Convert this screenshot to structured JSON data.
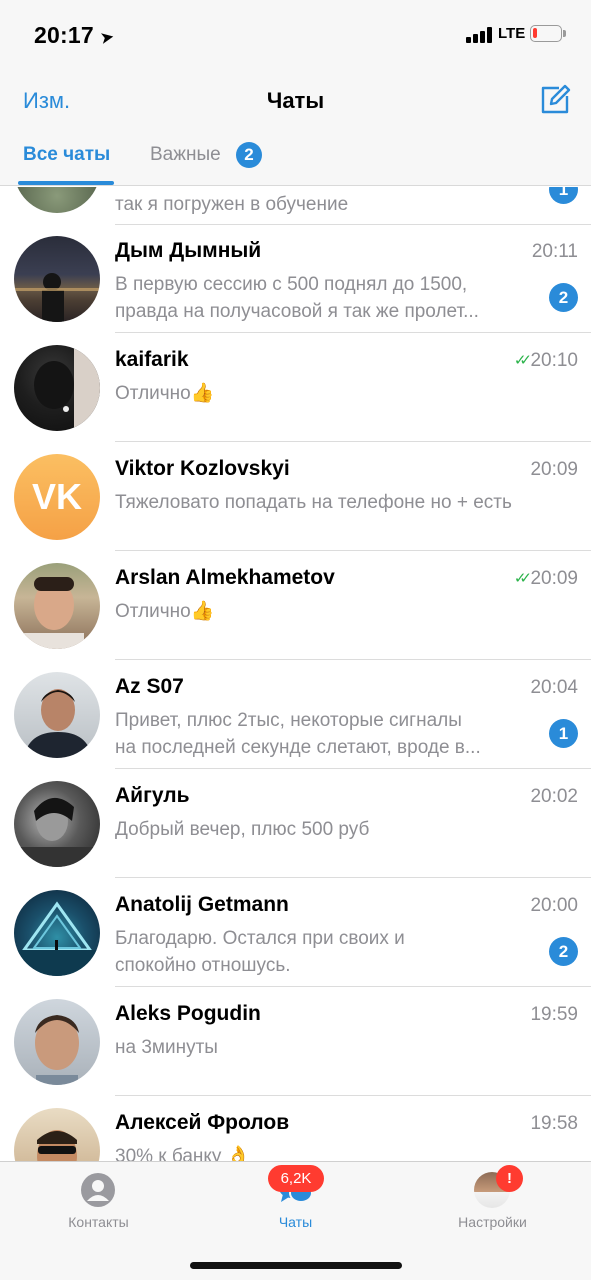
{
  "status_bar": {
    "time": "20:17",
    "network": "LTE"
  },
  "nav": {
    "edit_label": "Изм.",
    "title": "Чаты"
  },
  "filter_tabs": {
    "all_label": "Все чаты",
    "important_label": "Важные",
    "important_badge": "2"
  },
  "chats": [
    {
      "name": "",
      "time": "",
      "preview_1": "так я погружен в обучение",
      "preview_2": "",
      "badge": "1",
      "read": false,
      "avatar_icon": "photo-avatar"
    },
    {
      "name": "Дым Дымный",
      "time": "20:11",
      "preview_1": "В первую сессию с 500 поднял до 1500,",
      "preview_2": "правда на получасовой я так же пролет...",
      "badge": "2",
      "read": false,
      "avatar_icon": "photo-avatar"
    },
    {
      "name": "kaifarik",
      "time": "20:10",
      "preview_1": "Отлично👍",
      "preview_2": "",
      "badge": "",
      "read": true,
      "avatar_icon": "photo-avatar"
    },
    {
      "name": "Viktor Kozlovskyi",
      "time": "20:09",
      "preview_1": "Тяжеловато попадать на телефоне но + есть",
      "preview_2": "",
      "badge": "",
      "read": false,
      "avatar_text": "VK"
    },
    {
      "name": "Arslan Almekhametov",
      "time": "20:09",
      "preview_1": "Отлично👍",
      "preview_2": "",
      "badge": "",
      "read": true,
      "avatar_icon": "photo-avatar"
    },
    {
      "name": "Az S07",
      "time": "20:04",
      "preview_1": "Привет, плюс 2тыс, некоторые сигналы",
      "preview_2": "на последней секунде слетают, вроде в...",
      "badge": "1",
      "read": false,
      "avatar_icon": "photo-avatar"
    },
    {
      "name": "Айгуль",
      "time": "20:02",
      "preview_1": "Добрый вечер, плюс 500 руб",
      "preview_2": "",
      "badge": "",
      "read": false,
      "avatar_icon": "photo-avatar"
    },
    {
      "name": "Anatolij Getmann",
      "time": "20:00",
      "preview_1": "Благодарю. Остался при своих и",
      "preview_2": "спокойно отношусь.",
      "badge": "2",
      "read": false,
      "avatar_icon": "photo-avatar"
    },
    {
      "name": "Aleks Pogudin",
      "time": "19:59",
      "preview_1": "на 3минуты",
      "preview_2": "",
      "badge": "",
      "read": false,
      "avatar_icon": "photo-avatar"
    },
    {
      "name": "Алексей Фролов",
      "time": "19:58",
      "preview_1": "30% к банку 👌",
      "preview_2": "",
      "badge": "",
      "read": false,
      "avatar_icon": "photo-avatar"
    }
  ],
  "tab_bar": {
    "contacts_label": "Контакты",
    "chats_label": "Чаты",
    "chats_badge": "6,2K",
    "settings_label": "Настройки",
    "settings_badge": "!"
  },
  "colors": {
    "accent": "#2a8bd9",
    "read_ticks": "#2bb34a",
    "badge_red": "#ff3b30",
    "vk_avatar": "#f9ac4e"
  }
}
